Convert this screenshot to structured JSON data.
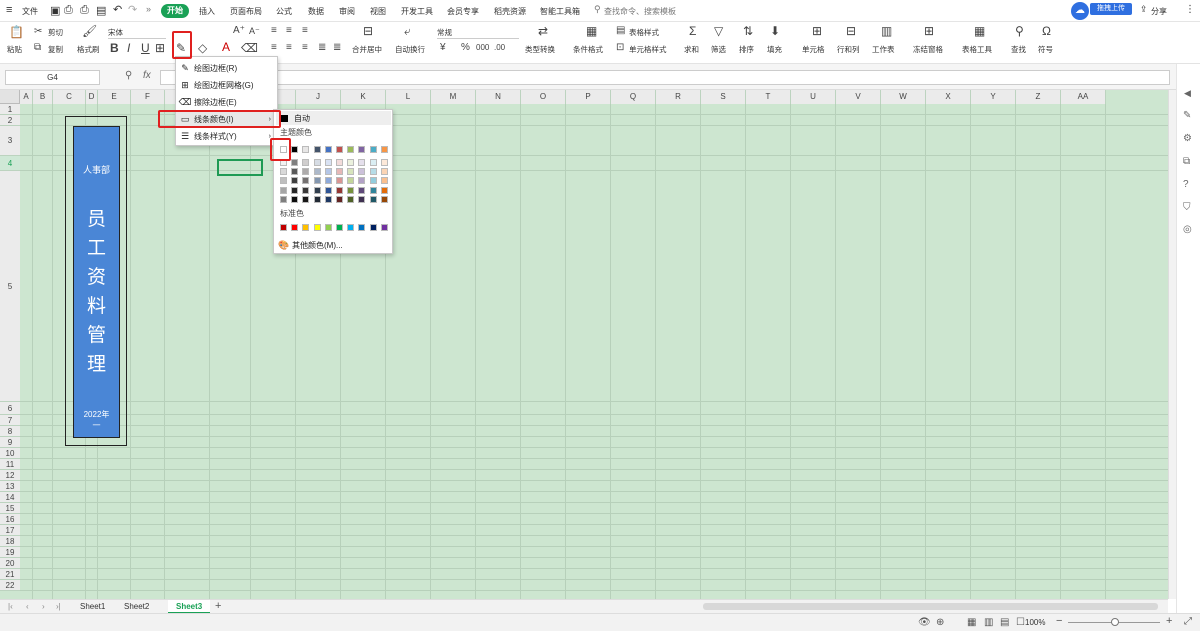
{
  "menubar": {
    "file": "文件",
    "tabs": [
      "开始",
      "插入",
      "页面布局",
      "公式",
      "数据",
      "审阅",
      "视图",
      "开发工具",
      "会员专享",
      "稻壳资源",
      "智能工具箱"
    ],
    "active_tab": "开始",
    "search_placeholder": "查找命令、搜索模板",
    "upload": "拖拽上传",
    "share": "分享"
  },
  "ribbon": {
    "cut": "剪切",
    "paste": "粘贴",
    "copy": "复制",
    "format_painter": "格式刷",
    "font": "宋体",
    "number_format": "常规",
    "merge": "合并居中",
    "wrap": "自动换行",
    "type_convert": "类型转换",
    "cond_format": "条件格式",
    "table_style": "表格样式",
    "cell_style": "单元格样式",
    "sum": "求和",
    "filter": "筛选",
    "sort": "排序",
    "fill": "填充",
    "cell": "单元格",
    "rowcol": "行和列",
    "worksheet": "工作表",
    "freeze": "冻结窗格",
    "table_tools": "表格工具",
    "find": "查找",
    "symbol": "符号"
  },
  "formula": {
    "cell_ref": "G4",
    "fx": "fx"
  },
  "columns": [
    "A",
    "B",
    "C",
    "D",
    "E",
    "F",
    "G",
    "H",
    "I",
    "J",
    "K",
    "L",
    "M",
    "N",
    "O",
    "P",
    "Q",
    "R",
    "S",
    "T",
    "U",
    "V",
    "W",
    "X",
    "Y",
    "Z",
    "AA"
  ],
  "rows": [
    "1",
    "2",
    "3",
    "4",
    "5",
    "6",
    "7",
    "8",
    "9",
    "10",
    "11",
    "12",
    "13",
    "14",
    "15",
    "16",
    "17",
    "18",
    "19",
    "20",
    "21",
    "22"
  ],
  "card": {
    "dept": "人事部",
    "title": [
      "员",
      "工",
      "资",
      "料",
      "管",
      "理"
    ],
    "year": "2022年",
    "year2": "一"
  },
  "border_menu": {
    "items": [
      "绘图边框(R)",
      "绘图边框网格(G)",
      "擦除边框(E)",
      "线条颜色(I)",
      "线条样式(Y)"
    ]
  },
  "color_menu": {
    "auto": "自动",
    "theme_label": "主题颜色",
    "standard_label": "标准色",
    "more": "其他颜色(M)...",
    "theme_row": [
      "#ffffff",
      "#000000",
      "#e7e6e6",
      "#44546a",
      "#4472c4",
      "#c0504d",
      "#9bbb59",
      "#8064a2",
      "#4bacc6",
      "#f79646"
    ],
    "shade_rows": [
      [
        "#f2f2f2",
        "#7f7f7f",
        "#d0cece",
        "#d6dce4",
        "#d9e2f3",
        "#f2dcdb",
        "#ebf1de",
        "#e5e0ec",
        "#dbeef3",
        "#fde9d9"
      ],
      [
        "#d9d9d9",
        "#595959",
        "#aeabab",
        "#adb9ca",
        "#b4c6e7",
        "#e6b8b7",
        "#d7e4bd",
        "#ccc1da",
        "#b7dde8",
        "#fbd5b5"
      ],
      [
        "#bfbfbf",
        "#3f3f3f",
        "#757171",
        "#8497b0",
        "#8eaadb",
        "#d99694",
        "#c3d69b",
        "#b3a2c7",
        "#93cddd",
        "#fac08f"
      ],
      [
        "#a6a6a6",
        "#262626",
        "#3a3838",
        "#323f4f",
        "#2f5597",
        "#953734",
        "#76923c",
        "#5f497a",
        "#31859b",
        "#e36c09"
      ],
      [
        "#7f7f7f",
        "#0d0d0d",
        "#171616",
        "#222a35",
        "#1f3864",
        "#632423",
        "#4f6228",
        "#3f3151",
        "#205867",
        "#974806"
      ]
    ],
    "standard": [
      "#c00000",
      "#ff0000",
      "#ffc000",
      "#ffff00",
      "#92d050",
      "#00b050",
      "#00b0f0",
      "#0070c0",
      "#002060",
      "#7030a0"
    ]
  },
  "sheets": {
    "tabs": [
      "Sheet1",
      "Sheet2",
      "Sheet3"
    ],
    "active": "Sheet3"
  },
  "status": {
    "zoom": "100%"
  }
}
